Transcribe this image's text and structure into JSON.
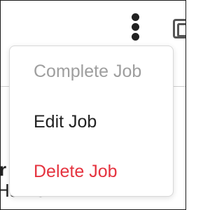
{
  "background": {
    "partial_text_line1": "r",
    "partial_text_line2": "Harris",
    "icons": {
      "more_menu": "more-vert-icon",
      "corner": "partial-corner-icon"
    }
  },
  "menu": {
    "items": [
      {
        "label": "Complete Job",
        "disabled": true
      },
      {
        "label": "Edit Job",
        "disabled": false
      },
      {
        "label": "Delete Job",
        "disabled": false,
        "destructive": true
      }
    ]
  },
  "colors": {
    "disabled_text": "#9e9e9e",
    "text": "#222222",
    "destructive": "#e5333f"
  }
}
